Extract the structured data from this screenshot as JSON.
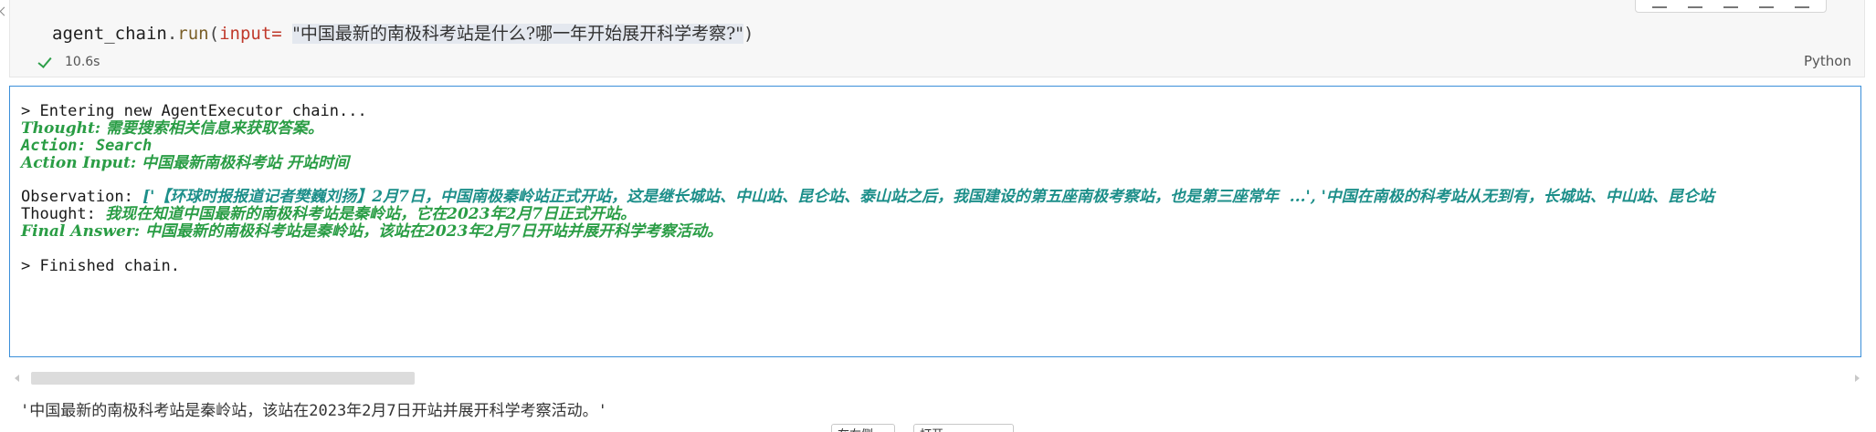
{
  "code_cell": {
    "code": {
      "var": "agent_chain",
      "dot": ".",
      "fn": "run",
      "open": "(",
      "param": "input",
      "eq": "= ",
      "str": "\"中国最新的南极科考站是什么?哪一年开始展开科学考察?\"",
      "close": ")"
    },
    "exec_time": "10.6s",
    "language": "Python"
  },
  "output": {
    "entering": "> Entering new AgentExecutor chain...",
    "thought1": "Thought: 需要搜索相关信息来获取答案。",
    "action": "Action: Search",
    "action_input": "Action Input: 中国最新南极科考站 开站时间",
    "observation_label": "Observation: ",
    "observation_text": "['【环球时报报道记者樊巍刘扬】2月7日，中国南极秦岭站正式开站，这是继长城站、中山站、昆仑站、泰山站之后，我国建设的第五座南极考察站，也是第三座常年  ...', '中国在南极的科考站从无到有，长城站、中山站、昆仑站",
    "thought2_label": "Thought: ",
    "thought2_text": "我现在知道中国最新的南极科考站是秦岭站，它在2023年2月7日正式开站。",
    "final_answer": "Final Answer: 中国最新的南极科考站是秦岭站，该站在2023年2月7日开站并展开科学考察活动。",
    "finished": "> Finished chain."
  },
  "result": "'中国最新的南极科考站是秦岭站，该站在2023年2月7日开站并展开科学考察活动。'",
  "bottom_buttons": [
    "在右侧",
    "打开..."
  ]
}
